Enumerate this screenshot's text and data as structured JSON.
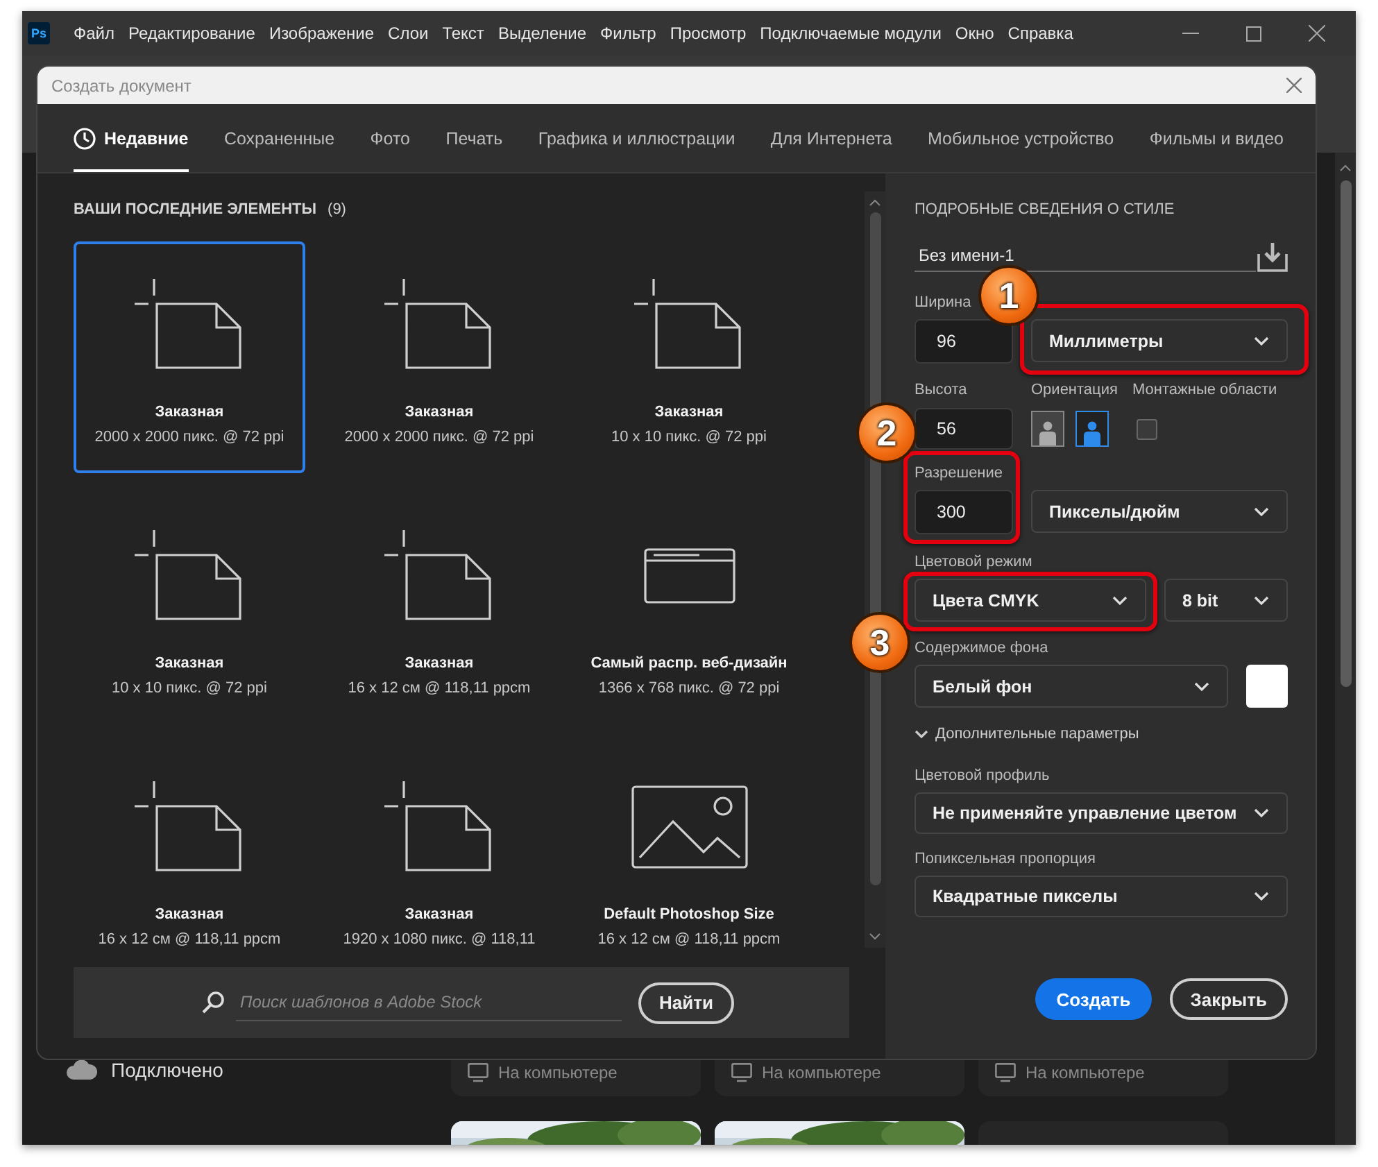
{
  "menu_bar": {
    "app_icon": "Ps",
    "items": [
      "Файл",
      "Редактирование",
      "Изображение",
      "Слои",
      "Текст",
      "Выделение",
      "Фильтр",
      "Просмотр",
      "Подключаемые модули",
      "Окно",
      "Справка"
    ]
  },
  "dialog": {
    "title": "Создать документ",
    "tabs": [
      {
        "label": "Недавние",
        "selected": true
      },
      {
        "label": "Сохраненные",
        "selected": false
      },
      {
        "label": "Фото",
        "selected": false
      },
      {
        "label": "Печать",
        "selected": false
      },
      {
        "label": "Графика и иллюстрации",
        "selected": false
      },
      {
        "label": "Для Интернета",
        "selected": false
      },
      {
        "label": "Мобильное устройство",
        "selected": false
      },
      {
        "label": "Фильмы и видео",
        "selected": false
      }
    ],
    "recent": {
      "heading": "ВАШИ ПОСЛЕДНИЕ ЭЛЕМЕНТЫ",
      "count": "(9)",
      "presets": [
        {
          "kind": "document",
          "title": "Заказная",
          "detail": "2000 x 2000 пикс. @ 72 ppi",
          "selected": true
        },
        {
          "kind": "document",
          "title": "Заказная",
          "detail": "2000 x 2000 пикс. @ 72 ppi",
          "selected": false
        },
        {
          "kind": "document",
          "title": "Заказная",
          "detail": "10 x 10 пикс. @ 72 ppi",
          "selected": false
        },
        {
          "kind": "document",
          "title": "Заказная",
          "detail": "10 x 10 пикс. @ 72 ppi",
          "selected": false
        },
        {
          "kind": "document",
          "title": "Заказная",
          "detail": "16 x 12 см @ 118,11 ppcm",
          "selected": false
        },
        {
          "kind": "web",
          "title": "Самый распр. веб-дизайн",
          "detail": "1366 x 768 пикс. @ 72 ppi",
          "selected": false
        },
        {
          "kind": "document",
          "title": "Заказная",
          "detail": "16 x 12 см @ 118,11 ppcm",
          "selected": false
        },
        {
          "kind": "document",
          "title": "Заказная",
          "detail": "1920 x 1080 пикс. @ 118,11",
          "selected": false
        },
        {
          "title": "Default Photoshop Size",
          "detail": "16 x 12 см @ 118,11 ppcm",
          "selected": false
        }
      ]
    },
    "search": {
      "placeholder": "Поиск шаблонов в Adobe Stock",
      "button": "Найти"
    },
    "details": {
      "heading": "ПОДРОБНЫЕ СВЕДЕНИЯ О СТИЛЕ",
      "name": "Без имени-1",
      "width": {
        "label": "Ширина",
        "value": "96",
        "unit": "Миллиметры"
      },
      "height": {
        "label": "Высота",
        "value": "56"
      },
      "orientation": {
        "label": "Ориентация",
        "options": [
          {
            "selected": false
          },
          {
            "selected": true
          }
        ]
      },
      "artboards": {
        "label": "Монтажные области",
        "checked": false
      },
      "resolution": {
        "label": "Разрешение",
        "value": "300",
        "unit": "Пикселы/дюйм"
      },
      "color_mode": {
        "label": "Цветовой режим",
        "value": "Цвета CMYK",
        "depth": "8 bit"
      },
      "background": {
        "label": "Содержимое фона",
        "value": "Белый фон"
      },
      "advanced": {
        "label": "Дополнительные параметры",
        "expanded": true
      },
      "color_profile": {
        "label": "Цветовой профиль",
        "value": "Не применяйте управление цветом"
      },
      "pixel_aspect": {
        "label": "Попиксельная пропорция",
        "value": "Квадратные пикселы"
      },
      "buttons": [
        "Создать",
        "Закрыть"
      ]
    }
  },
  "annotations": [
    {
      "number": "1"
    },
    {
      "number": "2"
    },
    {
      "number": "3"
    }
  ],
  "home": {
    "status": "Подключено",
    "locations": [
      "На компьютере",
      "На компьютере",
      "На компьютере"
    ],
    "thumbnails": [
      {
        "kind": "picture"
      },
      {
        "kind": "picture"
      },
      {
        "kind": "blank"
      }
    ]
  }
}
